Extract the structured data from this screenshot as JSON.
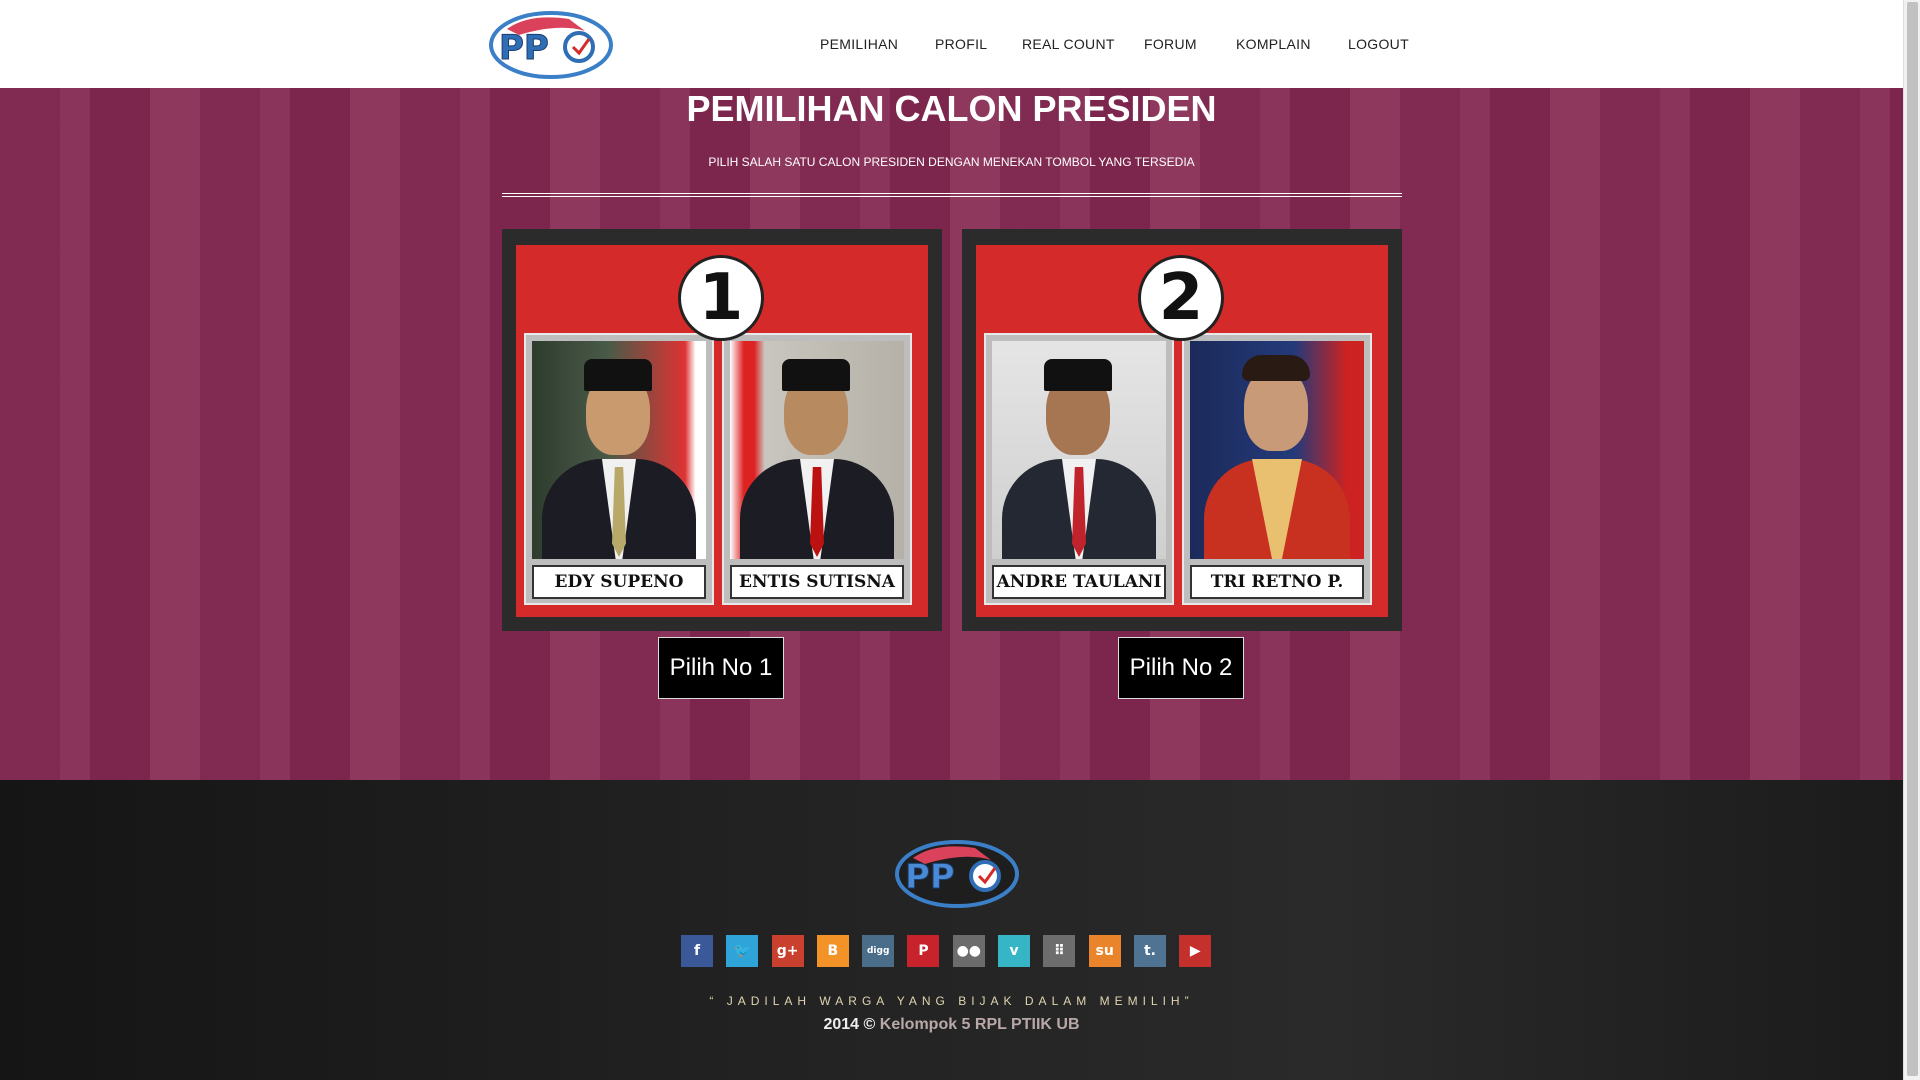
{
  "header": {
    "nav": [
      "PEMILIHAN",
      "PROFIL",
      "REAL COUNT",
      "FORUM",
      "KOMPLAIN",
      "LOGOUT"
    ]
  },
  "hero": {
    "title": "PEMILIHAN CALON PRESIDEN",
    "subtitle": "PILIH SALAH SATU CALON PRESIDEN DENGAN MENEKAN TOMBOL YANG TERSEDIA"
  },
  "candidates": [
    {
      "number": "1",
      "names": [
        "EDY SUPENO",
        "ENTIS SUTISNA"
      ],
      "button": "Pilih No 1"
    },
    {
      "number": "2",
      "names": [
        "ANDRE TAULANI",
        "TRI RETNO P."
      ],
      "button": "Pilih No 2"
    }
  ],
  "footer": {
    "social": [
      {
        "icon": "facebook-icon",
        "glyph": "f",
        "color": "#3b5998"
      },
      {
        "icon": "twitter-icon",
        "glyph": "🐦",
        "color": "#2fa4d9"
      },
      {
        "icon": "google-plus-icon",
        "glyph": "g+",
        "color": "#c9402f"
      },
      {
        "icon": "blogger-icon",
        "glyph": "B",
        "color": "#f29227"
      },
      {
        "icon": "digg-icon",
        "glyph": "digg",
        "color": "#4a6e8a"
      },
      {
        "icon": "pinterest-icon",
        "glyph": "P",
        "color": "#c8232c"
      },
      {
        "icon": "flickr-icon",
        "glyph": "●●",
        "color": "#6c6c6c"
      },
      {
        "icon": "vimeo-icon",
        "glyph": "v",
        "color": "#36b5c6"
      },
      {
        "icon": "myspace-icon",
        "glyph": "⠿",
        "color": "#6d6d6d"
      },
      {
        "icon": "stumbleupon-icon",
        "glyph": "su",
        "color": "#e9842b"
      },
      {
        "icon": "tumblr-icon",
        "glyph": "t.",
        "color": "#4f7392"
      },
      {
        "icon": "youtube-icon",
        "glyph": "▶",
        "color": "#c4302b"
      }
    ],
    "quote": "“ JADILAH WARGA YANG BIJAK DALAM MEMILIH”",
    "copyright_prefix": "2014 ©",
    "copyright_link": "Kelompok 5 RPL PTIIK UB"
  }
}
